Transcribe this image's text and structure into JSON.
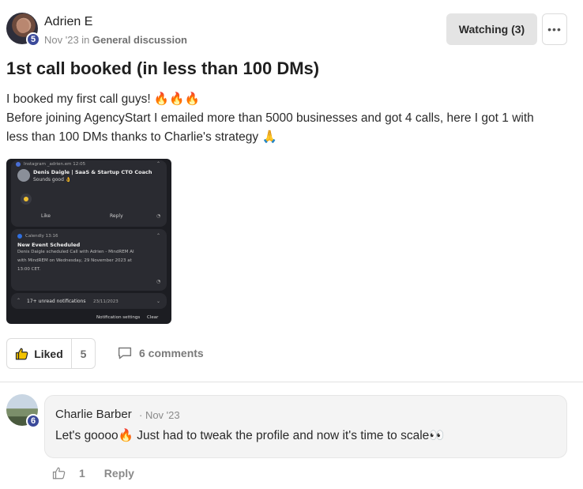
{
  "post": {
    "author": "Adrien E",
    "level": "5",
    "date": "Nov '23",
    "meta_in": " in ",
    "category": "General discussion",
    "watching_label": "Watching (3)",
    "more_label": "•••",
    "title": "1st call booked (in less than 100 DMs)",
    "body_lines": [
      "I booked my first call guys! 🔥🔥🔥",
      "Before joining AgencyStart I emailed more than 5000 businesses and got 4 calls, here I got 1 with",
      "less than 100 DMs thanks to Charlie's strategy 🙏"
    ],
    "liked_label": "Liked",
    "likes": "5",
    "comments_label": "6 comments"
  },
  "attachment": {
    "ig_header": "Instagram  _adrien.em  12:05",
    "dm_name": "Denis Daigle | SaaS & Startup CTO Coach",
    "dm_text": "Sounds good 👌",
    "like": "Like",
    "reply": "Reply",
    "cal_header": "Calendly  13:16",
    "event_title": "New Event Scheduled",
    "event_lines": [
      "Denis Daigle scheduled Call with Adrien - MindREM AI",
      "with MindREM on Wednesday, 29 November 2023 at",
      "13:00 CET."
    ],
    "unread": "17+ unread notifications",
    "unread_date": "23/11/2023",
    "notif_settings": "Notification settings",
    "clear": "Clear"
  },
  "comment": {
    "author": "Charlie Barber",
    "date": "· Nov '23",
    "level": "6",
    "text": "Let's goooo🔥 Just had to tweak the profile and now it's time to scale👀",
    "likes": "1",
    "reply_label": "Reply"
  },
  "colors": {
    "badge": "#3b4a9a",
    "watch_bg": "#e4e4e4",
    "bubble_bg": "#f4f4f4"
  }
}
